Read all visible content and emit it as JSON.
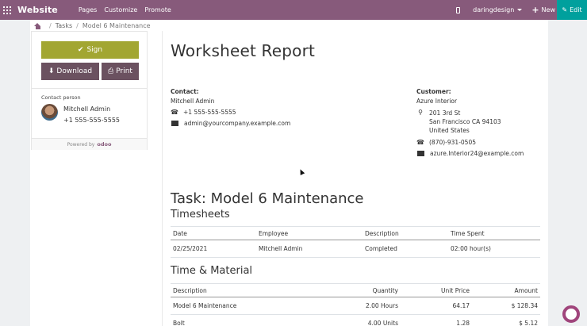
{
  "navbar": {
    "brand": "Website",
    "menu": [
      "Pages",
      "Customize",
      "Promote"
    ],
    "user": "daringdesign",
    "new_label": "New",
    "edit_label": "Edit",
    "bg_color": "#875a7b",
    "edit_color": "#00a09d"
  },
  "breadcrumb": {
    "items": [
      "Tasks",
      "Model 6 Maintenance"
    ]
  },
  "sidebar": {
    "sign_label": "Sign",
    "download_label": "Download",
    "print_label": "Print",
    "contact_label": "Contact person",
    "contact_name": "Mitchell Admin",
    "contact_phone": "+1 555-555-5555",
    "powered_by": "Powered by",
    "logo_text": "odoo",
    "sign_color": "#a2a632",
    "button_color": "#6b5160"
  },
  "report": {
    "title": "Worksheet Report",
    "contact": {
      "label": "Contact:",
      "name": "Mitchell Admin",
      "phone": "+1 555-555-5555",
      "email": "admin@yourcompany.example.com"
    },
    "customer": {
      "label": "Customer:",
      "name": "Azure Interior",
      "address": [
        "201 3rd St",
        "San Francisco CA 94103",
        "United States"
      ],
      "phone": "(870)-931-0505",
      "email": "azure.Interior24@example.com"
    },
    "task_title": "Task: Model 6 Maintenance",
    "timesheets": {
      "title": "Timesheets",
      "headers": [
        "Date",
        "Employee",
        "Description",
        "Time Spent"
      ],
      "rows": [
        [
          "02/25/2021",
          "Mitchell Admin",
          "Completed",
          "02:00 hour(s)"
        ]
      ]
    },
    "materials": {
      "title": "Time & Material",
      "headers": [
        "Description",
        "Quantity",
        "Unit Price",
        "Amount"
      ],
      "rows": [
        [
          "Model 6 Maintenance",
          "2.00 Hours",
          "64.17",
          "$ 128.34"
        ],
        [
          "Bolt",
          "4.00 Units",
          "1.28",
          "$ 5.12"
        ]
      ]
    }
  }
}
